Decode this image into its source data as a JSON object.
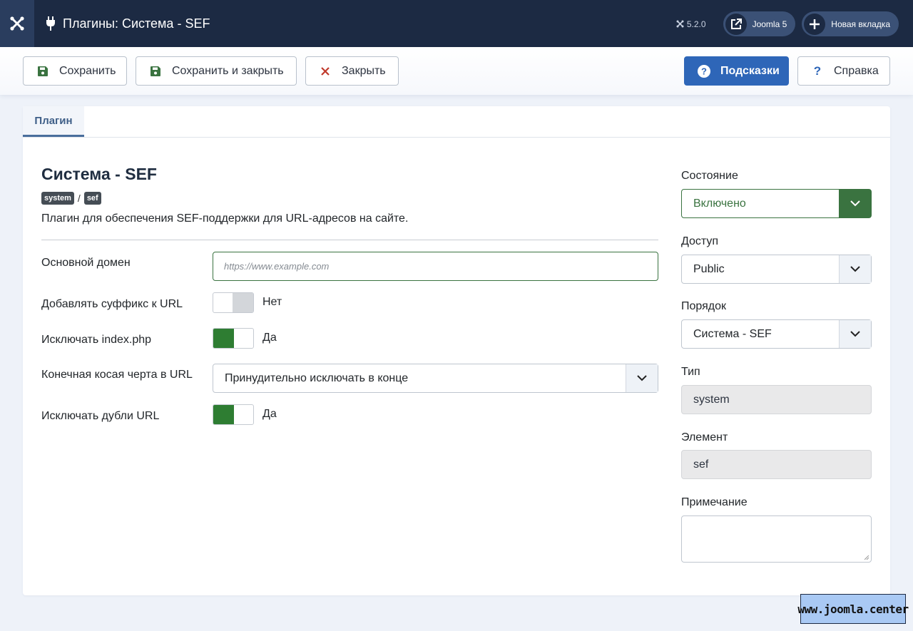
{
  "header": {
    "title": "Плагины: Система - SEF",
    "version": "5.2.0",
    "site_link_label": "Joomla 5",
    "new_tab_label": "Новая вкладка"
  },
  "toolbar": {
    "save_label": "Сохранить",
    "save_close_label": "Сохранить и закрыть",
    "close_label": "Закрыть",
    "hints_label": "Подсказки",
    "help_label": "Справка"
  },
  "tabs": [
    {
      "label": "Плагин"
    }
  ],
  "plugin": {
    "title": "Система - SEF",
    "folder": "system",
    "separator": "/",
    "element": "sef",
    "description": "Плагин для обеспечения SEF-поддержки для URL-адресов на сайте."
  },
  "fields": {
    "domain": {
      "label": "Основной домен",
      "placeholder": "https://www.example.com",
      "value": ""
    },
    "suffix": {
      "label": "Добавлять суффикс к URL",
      "state": "Нет"
    },
    "index_php": {
      "label": "Исключать index.php",
      "state": "Да"
    },
    "trailing_slash": {
      "label": "Конечная косая черта в URL",
      "value": "Принудительно исключать в конце"
    },
    "duplicates": {
      "label": "Исключать дубли URL",
      "state": "Да"
    }
  },
  "sidebar": {
    "status": {
      "label": "Состояние",
      "value": "Включено"
    },
    "access": {
      "label": "Доступ",
      "value": "Public"
    },
    "ordering": {
      "label": "Порядок",
      "value": "Система - SEF"
    },
    "type": {
      "label": "Тип",
      "value": "system"
    },
    "element": {
      "label": "Элемент",
      "value": "sef"
    },
    "note": {
      "label": "Примечание",
      "value": ""
    }
  },
  "watermark": "www.joomla.center",
  "colors": {
    "header_bg": "#1c2a43",
    "primary": "#2e66b8",
    "success": "#2e7d32",
    "tab_accent": "#4a6e9c",
    "watermark_bg": "#a9c9f4"
  },
  "icons": [
    "joomla-logo-icon",
    "plug-icon",
    "external-link-icon",
    "plus-icon",
    "save-icon",
    "close-x-icon",
    "question-circle-icon",
    "question-icon",
    "chevron-down-icon"
  ]
}
